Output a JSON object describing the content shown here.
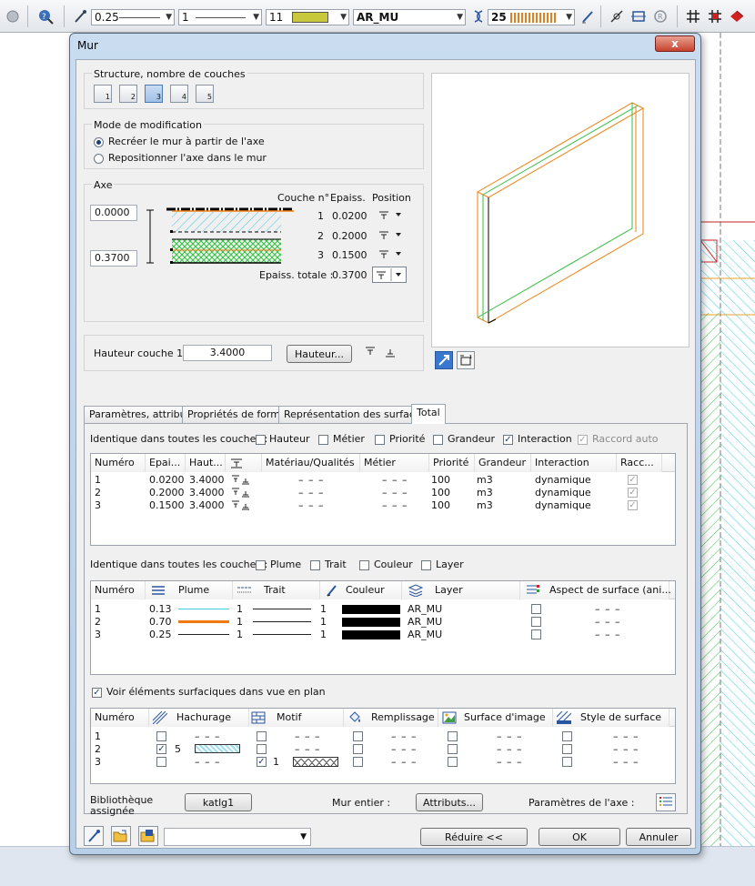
{
  "toolbar": {
    "pen_value": "0.25",
    "line_value": "1",
    "color_value": "11",
    "color_swatch": "#c8c83c",
    "layer_value": "AR_MU",
    "scale_value": "25"
  },
  "dialog": {
    "title": "Mur",
    "close_label": "x",
    "structure": {
      "label": "Structure, nombre de couches",
      "buttons": [
        "1",
        "2",
        "3",
        "4",
        "5"
      ],
      "active": 3
    },
    "mode": {
      "label": "Mode de modification",
      "option1": "Recréer le mur à partir de l'axe",
      "option2": "Repositionner l'axe dans le mur",
      "selected": 1
    },
    "axe": {
      "label": "Axe",
      "value_top": "0.0000",
      "value_bottom": "0.3700",
      "col_couche": "Couche n°",
      "col_epaiss": "Epaiss.",
      "col_position": "Position",
      "layers": [
        {
          "n": "1",
          "e": "0.0200"
        },
        {
          "n": "2",
          "e": "0.2000"
        },
        {
          "n": "3",
          "e": "0.1500"
        }
      ],
      "total_label": "Epaiss. totale :",
      "total_value": "0.3700"
    },
    "hauteur": {
      "label": "Hauteur couche 1 :",
      "value": "3.4000",
      "button": "Hauteur..."
    },
    "tabs": [
      "Paramètres, attributs",
      "Propriétés de format",
      "Représentation des surfaces",
      "Total"
    ],
    "active_tab": 3,
    "total": {
      "identique1": {
        "label": "Identique dans toutes les couches :",
        "items": [
          {
            "label": "Hauteur",
            "checked": false,
            "disabled": false
          },
          {
            "label": "Métier",
            "checked": false,
            "disabled": false
          },
          {
            "label": "Priorité",
            "checked": false,
            "disabled": false
          },
          {
            "label": "Grandeur",
            "checked": false,
            "disabled": false
          },
          {
            "label": "Interaction",
            "checked": true,
            "disabled": false
          },
          {
            "label": "Raccord auto",
            "checked": true,
            "disabled": true
          }
        ]
      },
      "table1": {
        "headers": [
          "Numéro",
          "Epai...",
          "Haut...",
          "",
          "Matériau/Qualités",
          "Métier",
          "Priorité",
          "Grandeur",
          "Interaction",
          "Racc..."
        ],
        "rows": [
          {
            "num": "1",
            "ep": "0.0200",
            "haut": "3.4000",
            "mat": "– – –",
            "metier": "– – –",
            "prio": "100",
            "grand": "m3",
            "inter": "dynamique"
          },
          {
            "num": "2",
            "ep": "0.2000",
            "haut": "3.4000",
            "mat": "– – –",
            "metier": "– – –",
            "prio": "100",
            "grand": "m3",
            "inter": "dynamique"
          },
          {
            "num": "3",
            "ep": "0.1500",
            "haut": "3.4000",
            "mat": "– – –",
            "metier": "– – –",
            "prio": "100",
            "grand": "m3",
            "inter": "dynamique"
          }
        ]
      },
      "identique2": {
        "label": "Identique dans toutes les couches :",
        "items": [
          {
            "label": "Plume",
            "checked": false
          },
          {
            "label": "Trait",
            "checked": false
          },
          {
            "label": "Couleur",
            "checked": false
          },
          {
            "label": "Layer",
            "checked": false
          }
        ]
      },
      "table2": {
        "headers": [
          "Numéro",
          "Plume",
          "Trait",
          "Couleur",
          "Layer",
          "Aspect de surface (ani..."
        ],
        "rows": [
          {
            "num": "1",
            "plume": "0.13",
            "pcolor": "#40d0e0",
            "pw": 1,
            "trait": "1",
            "couleur": "1",
            "layer": "AR_MU",
            "aspect": "– – –"
          },
          {
            "num": "2",
            "plume": "0.70",
            "pcolor": "#f07a10",
            "pw": 3,
            "trait": "1",
            "couleur": "1",
            "layer": "AR_MU",
            "aspect": "– – –"
          },
          {
            "num": "3",
            "plume": "0.25",
            "pcolor": "#202020",
            "pw": 1,
            "trait": "1",
            "couleur": "1",
            "layer": "AR_MU",
            "aspect": "– – –"
          }
        ]
      },
      "voir": {
        "label": "Voir éléments surfaciques dans vue en plan",
        "checked": true
      },
      "table3": {
        "headers": [
          "Numéro",
          "Hachurage",
          "Motif",
          "Remplissage",
          "Surface d'image",
          "Style de surface"
        ],
        "rows": [
          {
            "num": "1",
            "hach": "– – –",
            "motif": "– – –",
            "rempl": "– – –",
            "surf": "– – –",
            "style": "– – –"
          },
          {
            "num": "2",
            "hach_num": "5",
            "motif": "– – –",
            "rempl": "– – –",
            "surf": "– – –",
            "style": "– – –"
          },
          {
            "num": "3",
            "hach": "– – –",
            "motif_num": "1",
            "rempl": "– – –",
            "surf": "– – –",
            "style": "– – –"
          }
        ]
      },
      "biblio_label": "Bibliothèque assignée",
      "biblio_button": "katlg1",
      "mur_label": "Mur entier :",
      "mur_button": "Attributs...",
      "axe_label": "Paramètres de l'axe :"
    },
    "footer": {
      "reduire": "Réduire <<",
      "ok": "OK",
      "annuler": "Annuler"
    }
  }
}
